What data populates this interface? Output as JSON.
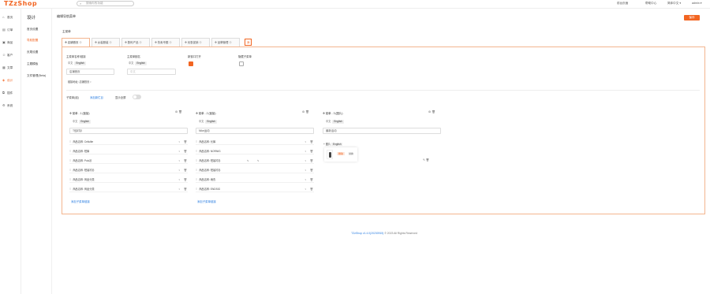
{
  "app": {
    "logo": "TZzShop"
  },
  "search": {
    "placeholder": "搜索你的功能"
  },
  "topnav": {
    "item1": "前台页面",
    "item2": "帮助中心",
    "item3": "简体中文 ▾",
    "item4": "admin ▾"
  },
  "sidebar": {
    "items": [
      {
        "label": "首页",
        "icon": "home-icon"
      },
      {
        "label": "订单",
        "icon": "order-icon"
      },
      {
        "label": "商品",
        "icon": "goods-icon"
      },
      {
        "label": "客户",
        "icon": "customer-icon"
      },
      {
        "label": "文章",
        "icon": "article-icon"
      },
      {
        "label": "设计",
        "icon": "design-icon"
      },
      {
        "label": "插件",
        "icon": "plugin-icon"
      },
      {
        "label": "系统",
        "icon": "settings-icon"
      }
    ]
  },
  "subsidebar": {
    "head": "设计",
    "items": [
      "首页设置",
      "导航配置",
      "页尾设置",
      "主题模板",
      "文件管理(Beta)"
    ]
  },
  "main": {
    "title": "编辑导航菜单",
    "save": "保存"
  },
  "menu": {
    "section_label": "主菜单",
    "tabs": [
      "店铺首页",
      "女装服装",
      "数码产品",
      "热卖专题",
      "优惠促销",
      "品牌管理"
    ],
    "add_tab": "添加菜单项"
  },
  "form": {
    "name_label": "主菜单名称/链接",
    "lang_zh": "中文",
    "lang_en": "English",
    "name_value": "店铺首页",
    "link_value": "链接地址: 店铺首页",
    "sub_label": "主菜单副名",
    "sub_placeholder": "中文",
    "new_window_label": "新窗口打开",
    "hide_label": "隐藏子菜单"
  },
  "submenu": {
    "label": "子菜单(组)",
    "add_link": "添加新栏目",
    "show_label": "显示全屏"
  },
  "columns": [
    {
      "head": "✣ 菜单 - 1 (链接)",
      "name": "T恤衬衫",
      "items": [
        "商品名称: Cellulite",
        "商品名称: 短裤",
        "商品名称: Polo衫",
        "商品名称: 短袖衬衫",
        "商品名称: 商品分类",
        "商品名称: 商品分类"
      ],
      "add": "添加子菜单链接"
    },
    {
      "head": "✣ 菜单 - 2 (链接)",
      "name": "Nike运动",
      "items": [
        "商品名称: 长裤",
        "商品名称: NORNIG",
        "商品名称: 短袖衬衫",
        "商品名称: 短袖衬衫",
        "商品名称: 雨衣",
        "商品名称: ENDSIG"
      ],
      "add": "添加子菜单链接"
    },
    {
      "head": "✣ 菜单 - 3 (图片)",
      "name": "最新活动",
      "image_label": "+ 图片",
      "image_lang": "English",
      "popup_a": "删除",
      "popup_b": "替换"
    }
  ],
  "footer": {
    "text": "TZzShop v1.4.0(20230915)",
    "rights": "© 2023 All Rights Reserved"
  },
  "colors": {
    "accent": "#f26522",
    "link": "#2a7de1"
  }
}
